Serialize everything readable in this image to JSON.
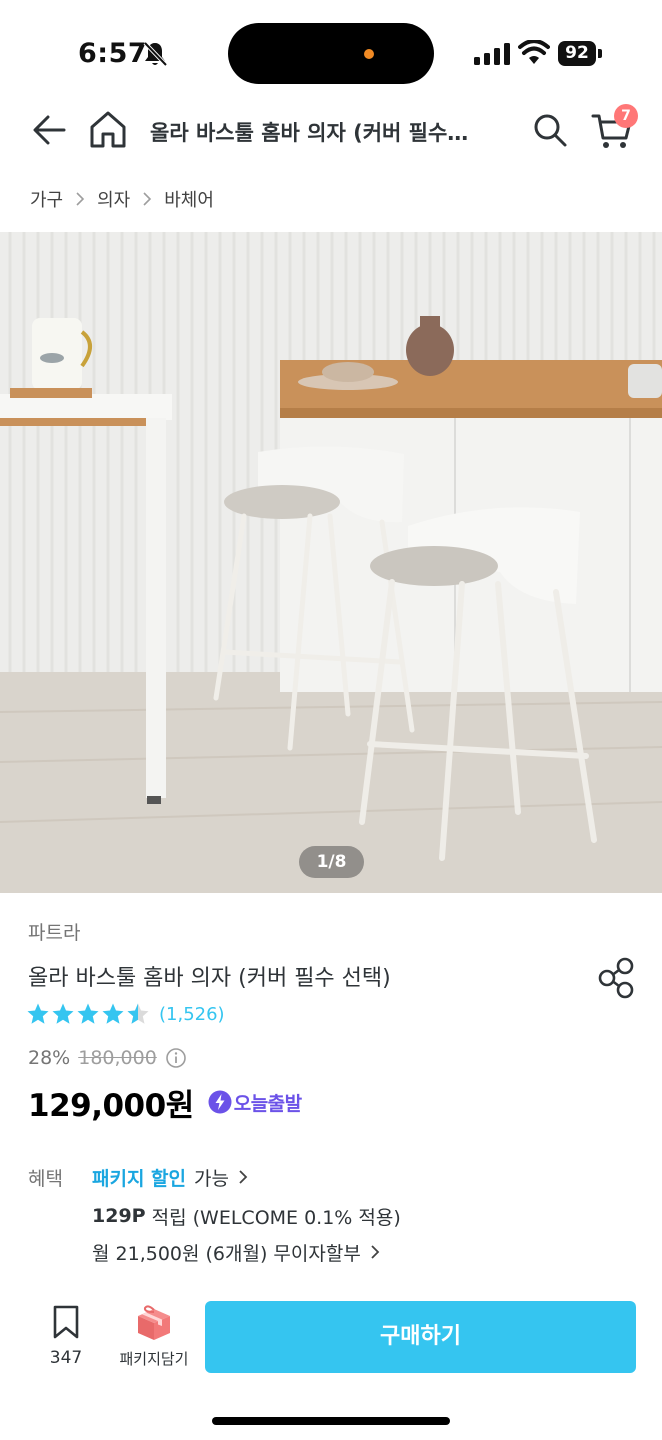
{
  "status_bar": {
    "time": "6:57",
    "battery": "92"
  },
  "header": {
    "title": "올라 바스툴 홈바 의자 (커버 필수…",
    "cart_badge": "7"
  },
  "breadcrumb": [
    "가구",
    "의자",
    "바체어"
  ],
  "gallery": {
    "page_indicator": "1/8"
  },
  "product": {
    "brand": "파트라",
    "name": "올라 바스툴 홈바 의자 (커버 필수 선택)",
    "rating": 4.5,
    "review_count": "(1,526)",
    "discount": "28%",
    "original_price": "180,000",
    "price": "129,000원",
    "delivery_badge": "오늘출발"
  },
  "benefits": {
    "label": "혜택",
    "package_link": "패키지 할인",
    "package_suffix": "가능",
    "points_strong": "129P",
    "points_text": " 적립 (WELCOME 0.1% 적용)",
    "installment": "월 21,500원 (6개월) 무이자할부"
  },
  "bottom_bar": {
    "bookmark_count": "347",
    "package_cart_label": "패키지담기",
    "buy_label": "구매하기"
  },
  "colors": {
    "accent": "#35c5f0",
    "badge": "#ff7777",
    "today_purple": "#6b52e8"
  }
}
